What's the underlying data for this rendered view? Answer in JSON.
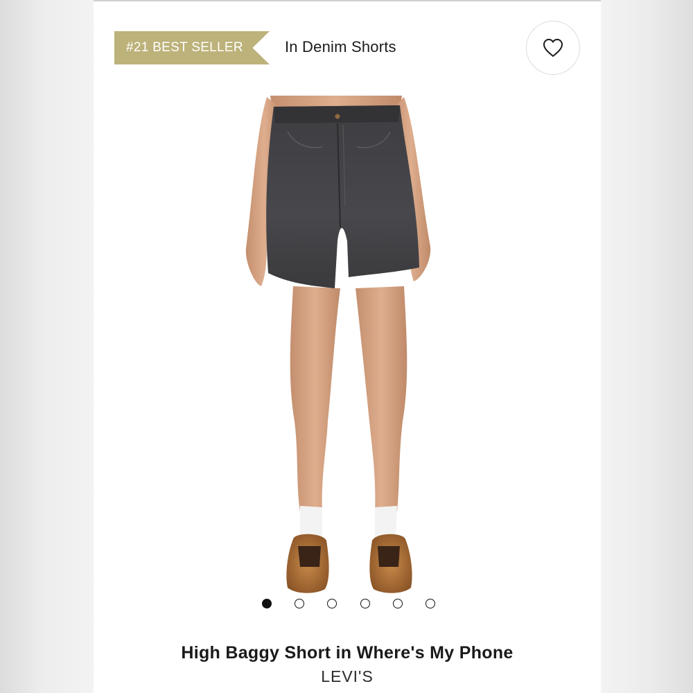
{
  "badge": {
    "text": "#21 BEST SELLER",
    "color": "#bcb27a"
  },
  "category": {
    "text": "In Denim Shorts"
  },
  "wishlist": {
    "icon": "heart-icon"
  },
  "image": {
    "subject": "model-wearing-black-denim-shorts",
    "total_images": 6,
    "active_index": 0
  },
  "product": {
    "title": "High Baggy Short in Where's My Phone",
    "brand": "LEVI'S"
  }
}
